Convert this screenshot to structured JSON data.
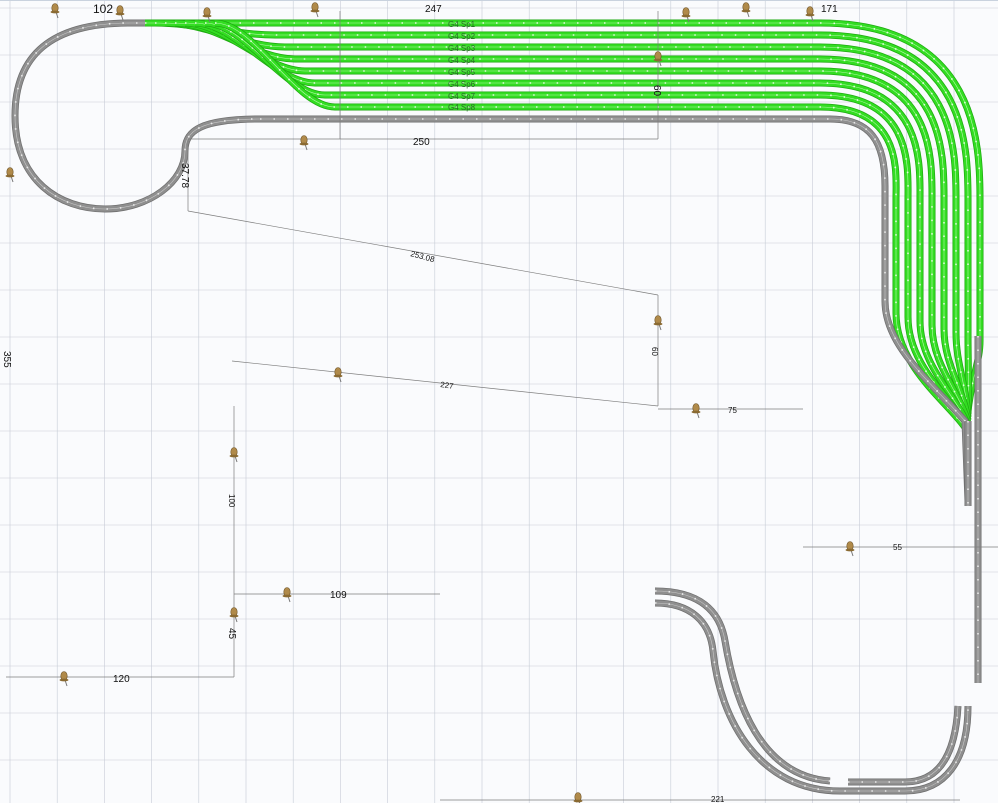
{
  "colors": {
    "grid": "#c7ccd6",
    "track_sleeper": "#8f8f8f",
    "track_rail": "#d7d7d7",
    "track_sleeper_dark": "#6f6f6f",
    "occupied_track": "#33dd22",
    "occupied_edge": "#1faa11",
    "dimension_line": "#7d7d7d",
    "pin_body": "#b08a4a"
  },
  "icons": {
    "marker": "pushpin-icon"
  },
  "dimensions": {
    "top_a": "102",
    "top_b": "247",
    "top_c": "171",
    "left_height": "355",
    "track_gap": "60",
    "span_250": "250",
    "vertical_3778": "37.78",
    "diag_25308": "253.08",
    "vertical_60": "60",
    "diag_227": "227",
    "horiz_75": "75",
    "vertical_100": "100",
    "horiz_109": "109",
    "vertical_45": "45",
    "horiz_120": "120",
    "right_small": "55",
    "bottom_small": "221"
  },
  "tracks": {
    "labels": [
      "G4 Sp1",
      "G4 Sp2",
      "G4 Sp3",
      "G4 Sp4",
      "G4 Sp5",
      "G4 Sp6",
      "G4 Sp7",
      "G4 Sp8"
    ]
  }
}
